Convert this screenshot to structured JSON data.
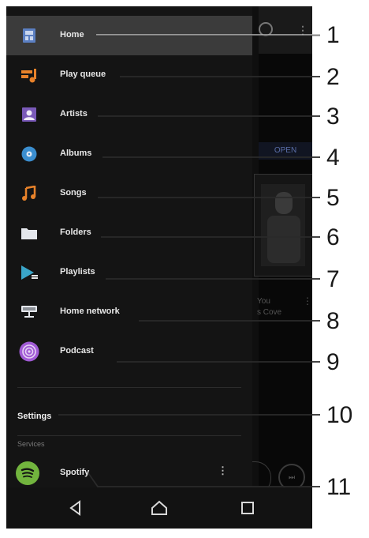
{
  "drawer": {
    "items": [
      {
        "label": "Home",
        "icon": "home-icon",
        "active": true
      },
      {
        "label": "Play queue",
        "icon": "play-queue-icon",
        "active": false
      },
      {
        "label": "Artists",
        "icon": "artists-icon",
        "active": false
      },
      {
        "label": "Albums",
        "icon": "albums-icon",
        "active": false
      },
      {
        "label": "Songs",
        "icon": "songs-icon",
        "active": false
      },
      {
        "label": "Folders",
        "icon": "folders-icon",
        "active": false
      },
      {
        "label": "Playlists",
        "icon": "playlists-icon",
        "active": false
      },
      {
        "label": "Home network",
        "icon": "home-network-icon",
        "active": false
      },
      {
        "label": "Podcast",
        "icon": "podcast-icon",
        "active": false
      }
    ],
    "settings_label": "Settings",
    "services_label": "Services",
    "spotify_label": "Spotify"
  },
  "background": {
    "open_label": "OPEN",
    "track_line1": "You",
    "track_line2": "s Cove"
  },
  "callouts": [
    "1",
    "2",
    "3",
    "4",
    "5",
    "6",
    "7",
    "8",
    "9",
    "10",
    "11"
  ],
  "colors": {
    "drawer_bg": "#141414",
    "active_item_bg": "#3b3b3b",
    "accent_orange": "#e8822a",
    "accent_blue": "#3b8ecf",
    "accent_purple": "#a15bd6",
    "spotify_green": "#72b43e"
  }
}
